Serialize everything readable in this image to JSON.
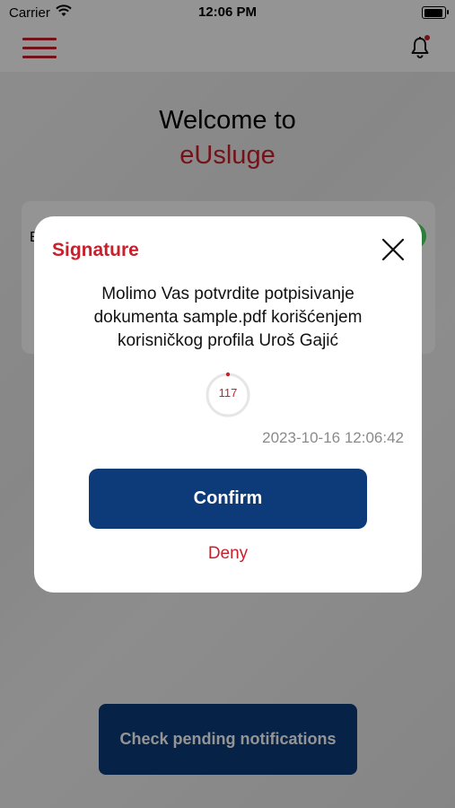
{
  "status_bar": {
    "carrier": "Carrier",
    "time": "12:06 PM"
  },
  "header": {
    "menu_icon": "hamburger-menu-icon",
    "bell_icon": "notification-bell-icon"
  },
  "home": {
    "welcome": "Welcome to",
    "brand": "eUsluge",
    "card_letter": "E",
    "pending_button": "Check pending notifications"
  },
  "modal": {
    "title": "Signature",
    "message": "Molimo Vas potvrdite potpisivanje dokumenta sample.pdf korišćenjem korisničkog profila Uroš Gajić",
    "timer": "117",
    "timestamp": "2023-10-16 12:06:42",
    "confirm": "Confirm",
    "deny": "Deny"
  },
  "colors": {
    "brand_red": "#c8202d",
    "primary_blue": "#0d3b7a"
  }
}
